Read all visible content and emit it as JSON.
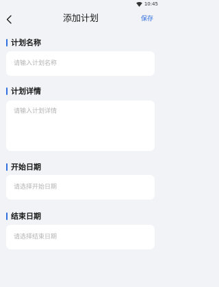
{
  "status_bar": {
    "time": "10:45",
    "signal_icon": "wifi-icon"
  },
  "header": {
    "back_icon": "chevron-left-icon",
    "title": "添加计划",
    "save_label": "保存"
  },
  "form": {
    "plan_name": {
      "label": "计划名称",
      "placeholder": "请输入计划名称"
    },
    "plan_detail": {
      "label": "计划详情",
      "placeholder": "请输入计划详情"
    },
    "start_date": {
      "label": "开始日期",
      "placeholder": "请选择开始日期"
    },
    "end_date": {
      "label": "结束日期",
      "placeholder": "请选择结束日期"
    }
  },
  "colors": {
    "accent": "#2f6fe0",
    "background": "#f2f3f7",
    "field_background": "#ffffff",
    "placeholder_text": "#b3b3b3"
  }
}
